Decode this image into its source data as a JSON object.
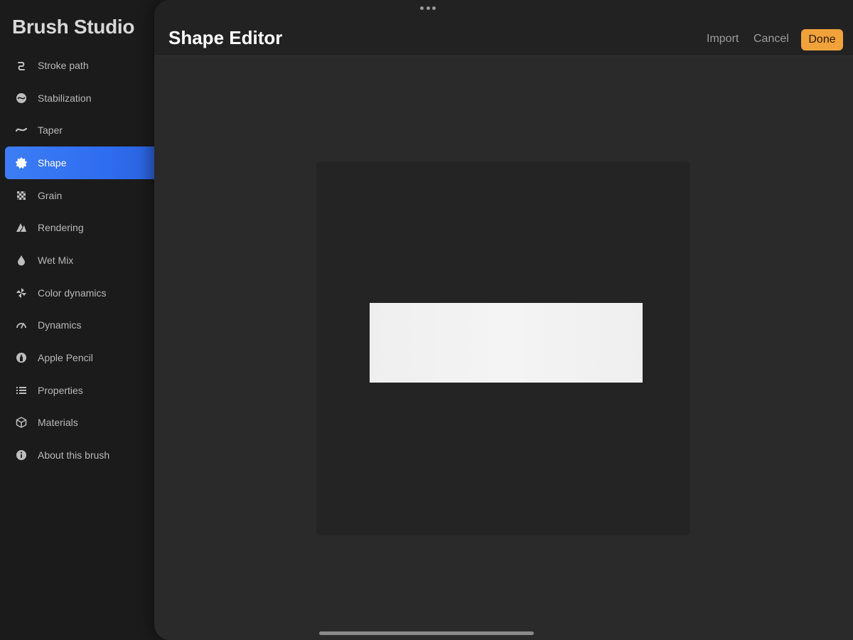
{
  "sidebar": {
    "title": "Brush Studio",
    "items": [
      {
        "label": "Stroke path",
        "icon": "stroke-path-icon",
        "active": false
      },
      {
        "label": "Stabilization",
        "icon": "stabilization-icon",
        "active": false
      },
      {
        "label": "Taper",
        "icon": "taper-icon",
        "active": false
      },
      {
        "label": "Shape",
        "icon": "shape-icon",
        "active": true
      },
      {
        "label": "Grain",
        "icon": "grain-icon",
        "active": false
      },
      {
        "label": "Rendering",
        "icon": "rendering-icon",
        "active": false
      },
      {
        "label": "Wet Mix",
        "icon": "wet-mix-icon",
        "active": false
      },
      {
        "label": "Color dynamics",
        "icon": "color-dynamics-icon",
        "active": false
      },
      {
        "label": "Dynamics",
        "icon": "dynamics-icon",
        "active": false
      },
      {
        "label": "Apple Pencil",
        "icon": "apple-pencil-icon",
        "active": false
      },
      {
        "label": "Properties",
        "icon": "properties-icon",
        "active": false
      },
      {
        "label": "Materials",
        "icon": "materials-icon",
        "active": false
      },
      {
        "label": "About this brush",
        "icon": "info-icon",
        "active": false
      }
    ]
  },
  "header": {
    "title": "Shape Editor",
    "import_label": "Import",
    "cancel_label": "Cancel",
    "done_label": "Done"
  },
  "colors": {
    "accent": "#f2a23a",
    "active_item": "#3173f2",
    "shape_fill": "#f1f1f1"
  }
}
